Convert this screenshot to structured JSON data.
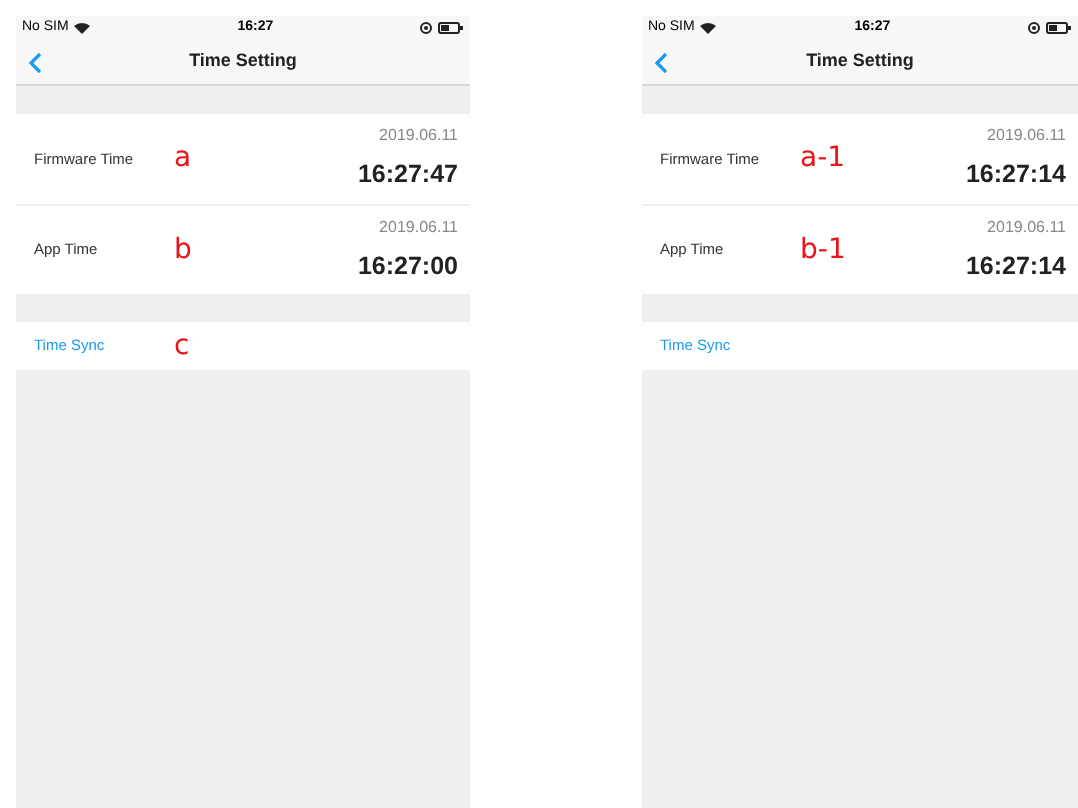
{
  "screens": [
    {
      "status": {
        "carrier": "No SIM",
        "time": "16:27"
      },
      "title": "Time Setting",
      "rows": [
        {
          "label": "Firmware Time",
          "annotation": "a",
          "date": "2019.06.11",
          "time": "16:27:47"
        },
        {
          "label": "App Time",
          "annotation": "b",
          "date": "2019.06.11",
          "time": "16:27:00"
        }
      ],
      "action": {
        "label": "Time Sync",
        "annotation": "c"
      }
    },
    {
      "status": {
        "carrier": "No SIM",
        "time": "16:27"
      },
      "title": "Time Setting",
      "rows": [
        {
          "label": "Firmware Time",
          "annotation": "a-1",
          "date": "2019.06.11",
          "time": "16:27:14"
        },
        {
          "label": "App Time",
          "annotation": "b-1",
          "date": "2019.06.11",
          "time": "16:27:14"
        }
      ],
      "action": {
        "label": "Time Sync"
      }
    }
  ]
}
